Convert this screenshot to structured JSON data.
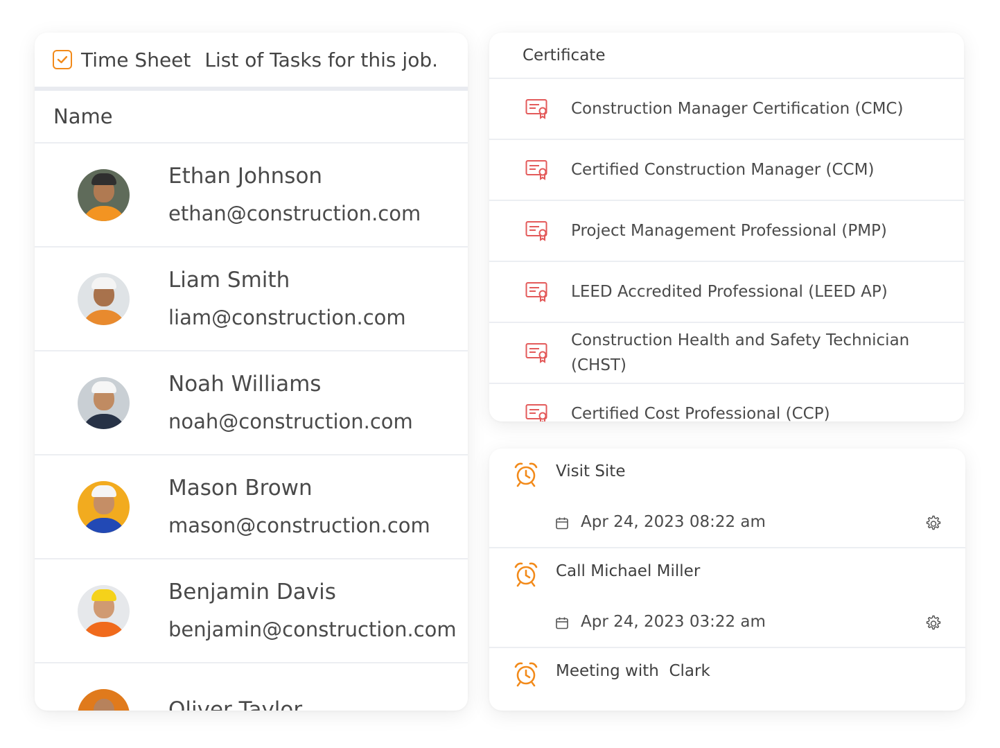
{
  "timesheet": {
    "title": "Time Sheet",
    "subtitle": "List of Tasks for this job.",
    "column_header": "Name",
    "people": [
      {
        "name": "Ethan Johnson",
        "email": "ethan@construction.com"
      },
      {
        "name": "Liam Smith",
        "email": "liam@construction.com"
      },
      {
        "name": "Noah Williams",
        "email": "noah@construction.com"
      },
      {
        "name": "Mason Brown",
        "email": "mason@construction.com"
      },
      {
        "name": "Benjamin Davis",
        "email": "benjamin@construction.com"
      },
      {
        "name": "Oliver Taylor",
        "email": ""
      }
    ]
  },
  "certificates": {
    "header": "Certificate",
    "items": [
      {
        "label": "Construction Manager Certification (CMC)"
      },
      {
        "label": "Certified Construction Manager (CCM)"
      },
      {
        "label": "Project Management Professional (PMP)"
      },
      {
        "label": "LEED Accredited Professional (LEED AP)"
      },
      {
        "label": "Construction Health and Safety Technician (CHST)"
      },
      {
        "label": "Certified Cost Professional (CCP)"
      }
    ]
  },
  "tasks": {
    "items": [
      {
        "title": "Visit Site",
        "date": "Apr 24, 2023 08:22 am"
      },
      {
        "title": "Call Michael Miller",
        "date": "Apr 24, 2023 03:22 am"
      },
      {
        "title": "Meeting with  Clark",
        "date": ""
      }
    ]
  },
  "colors": {
    "accent": "#f28a1a",
    "certificate_icon": "#e35a5a",
    "divider": "#eceef2"
  },
  "icons": {
    "header": "checkbox-icon",
    "certificate": "certificate-icon",
    "task": "alarm-clock-icon",
    "date": "calendar-icon",
    "settings": "gear-icon"
  }
}
